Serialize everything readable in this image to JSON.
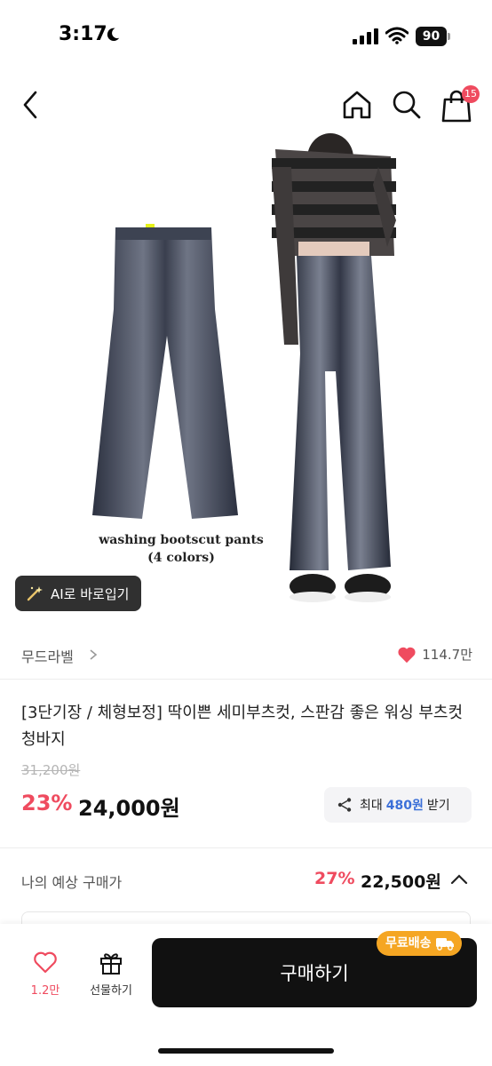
{
  "status_bar": {
    "time": "3:17",
    "battery": "90"
  },
  "nav": {
    "cart_badge": "15"
  },
  "product_image": {
    "caption_line1": "washing bootscut pants",
    "caption_line2": "(4 colors)"
  },
  "ai_button": {
    "label": "AI로 바로입기"
  },
  "brand": {
    "name": "무드라벨",
    "likes": "114.7만"
  },
  "product": {
    "title": "[3단기장 / 체형보정] 딱이쁜 세미부츠컷, 스판감 좋은 워싱 부츠컷 청바지",
    "original_price": "31,200원",
    "discount_rate": "23%",
    "sale_price": "24,000원"
  },
  "share_reward": {
    "prefix": "최대",
    "amount": "480원",
    "suffix": "받기"
  },
  "expected": {
    "label": "나의 예상 구매가",
    "rate": "27%",
    "price": "22,500원"
  },
  "bottom_bar": {
    "wish_count": "1.2만",
    "gift_label": "선물하기",
    "buy_label": "구매하기",
    "free_shipping": "무료배송"
  },
  "colors": {
    "accent": "#ef4b5f",
    "link": "#3b6fd8",
    "badge": "#f5a623",
    "dark": "#111111"
  }
}
